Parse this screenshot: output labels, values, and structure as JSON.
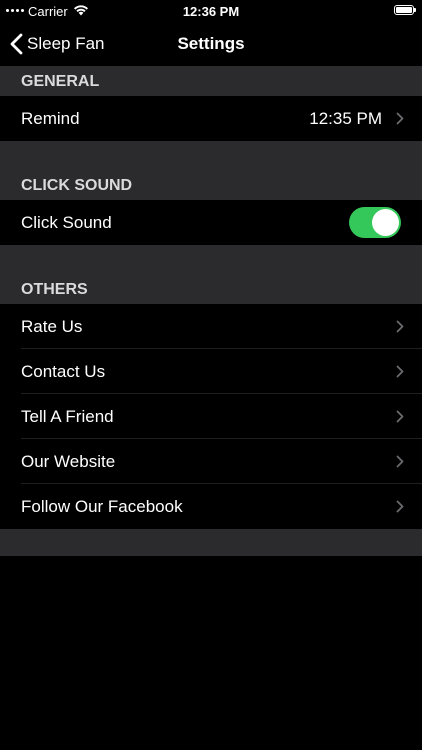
{
  "status_bar": {
    "carrier": "Carrier",
    "time": "12:36 PM"
  },
  "nav": {
    "back_label": "Sleep Fan",
    "title": "Settings"
  },
  "sections": {
    "general": {
      "header": "GENERAL",
      "remind_label": "Remind",
      "remind_value": "12:35 PM"
    },
    "click_sound": {
      "header": "CLICK SOUND",
      "toggle_label": "Click Sound",
      "toggle_on": true
    },
    "others": {
      "header": "OTHERS",
      "items": [
        {
          "label": "Rate Us"
        },
        {
          "label": "Contact Us"
        },
        {
          "label": "Tell A Friend"
        },
        {
          "label": "Our Website"
        },
        {
          "label": "Follow Our Facebook"
        }
      ]
    }
  },
  "colors": {
    "background": "#000000",
    "section_header_bg": "#2b2b2d",
    "toggle_on": "#34c759",
    "chevron": "#6c6c70"
  }
}
